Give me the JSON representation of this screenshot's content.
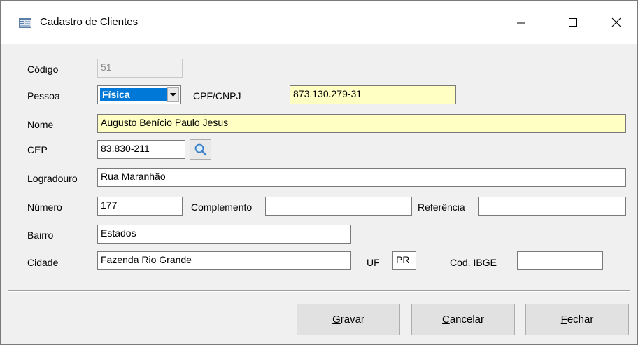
{
  "window": {
    "title": "Cadastro de Clientes",
    "icon": "form-icon",
    "controls": [
      "minimize-icon",
      "maximize-icon",
      "close-icon"
    ]
  },
  "form": {
    "codigo": {
      "label": "Código",
      "value": "51"
    },
    "pessoa": {
      "label": "Pessoa",
      "value": "Física"
    },
    "cpf_cnpj": {
      "label": "CPF/CNPJ",
      "value": "873.130.279-31"
    },
    "nome": {
      "label": "Nome",
      "value": "Augusto Benício Paulo Jesus"
    },
    "cep": {
      "label": "CEP",
      "value": "83.830-211",
      "search_icon": "magnifier-icon"
    },
    "logradouro": {
      "label": "Logradouro",
      "value": "Rua Maranhão"
    },
    "numero": {
      "label": "Número",
      "value": "177"
    },
    "complemento": {
      "label": "Complemento",
      "value": ""
    },
    "referencia": {
      "label": "Referência",
      "value": ""
    },
    "bairro": {
      "label": "Bairro",
      "value": "Estados"
    },
    "cidade": {
      "label": "Cidade",
      "value": "Fazenda Rio Grande"
    },
    "uf": {
      "label": "UF",
      "value": "PR"
    },
    "cod_ibge": {
      "label": "Cod. IBGE",
      "value": ""
    }
  },
  "buttons": {
    "gravar": {
      "accel": "G",
      "rest": "ravar"
    },
    "cancelar": {
      "accel": "C",
      "rest": "ancelar"
    },
    "fechar": {
      "accel": "F",
      "rest": "echar"
    }
  },
  "colors": {
    "required_field": "#ffffc4",
    "selection": "#0078d7",
    "window_bg": "#f0f0f0"
  }
}
